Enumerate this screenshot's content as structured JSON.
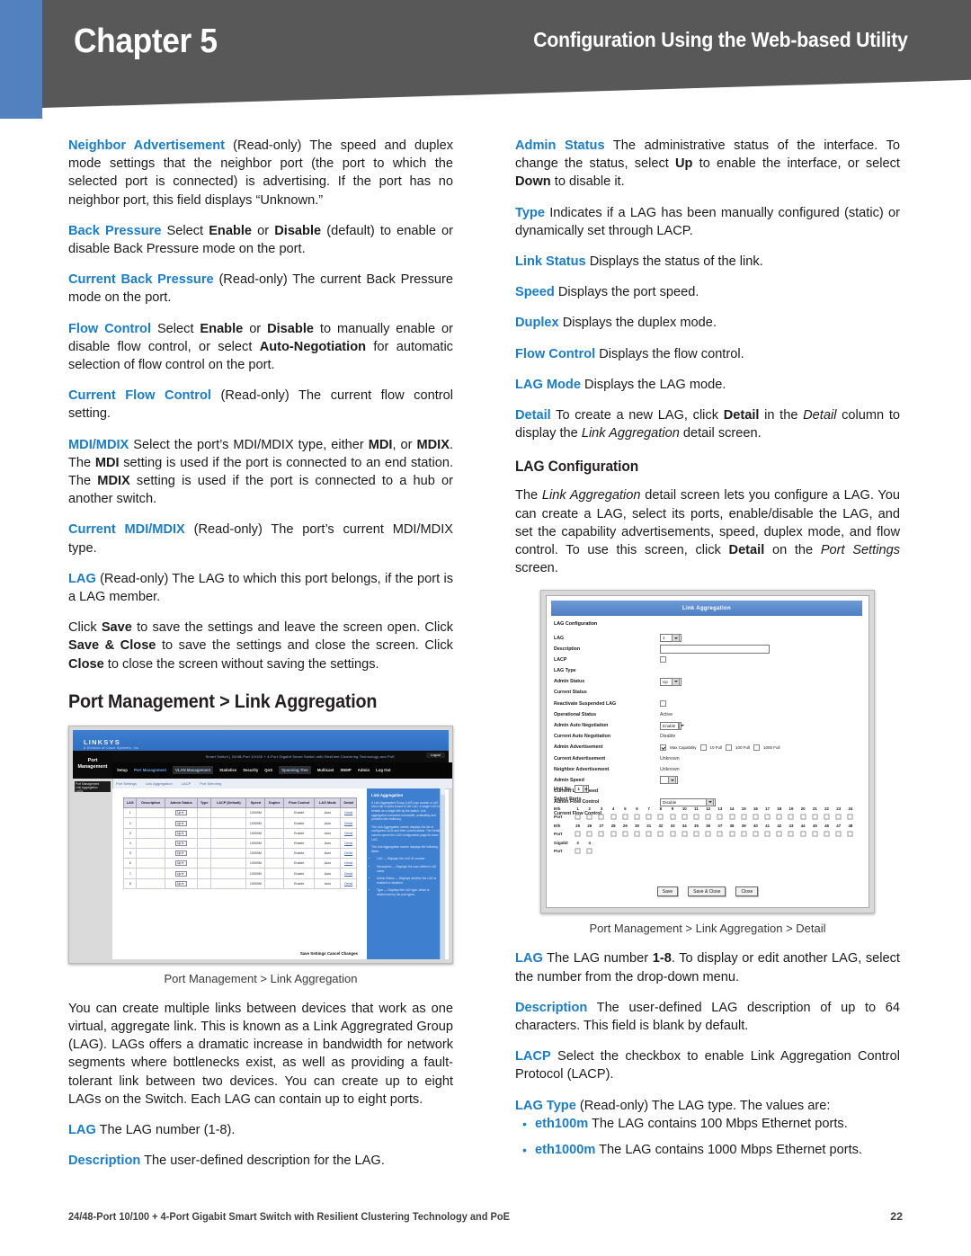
{
  "header": {
    "chapter_label": "Chapter",
    "chapter_number": "5",
    "chapter_title": "Chapter 5",
    "section_title": "Configuration Using the Web-based Utility",
    "bar_color": "#585858",
    "accent_color": "#5381bf"
  },
  "theme": {
    "lead_color": "#1c7cc4",
    "body_color": "#1b1b1b"
  },
  "left_column": {
    "paragraphs": [
      {
        "lead": "Neighbor Advertisement",
        "text": " (Read-only) The speed and duplex mode settings that the neighbor port (the port to which the selected port is connected) is advertising. If the port has no neighbor port, this field displays “Unknown.”"
      },
      {
        "lead": "Back Pressure",
        "text": " Select Enable or Disable (default) to enable or disable Back Pressure mode on the port."
      },
      {
        "lead": "Current Back Pressure",
        "text": " (Read-only) The current Back Pressure mode on the port."
      },
      {
        "lead": "Flow Control",
        "text": " Select Enable or Disable to manually enable or disable flow control, or select Auto-Negotiation for automatic selection of flow control on the port."
      },
      {
        "lead": "Current Flow Control",
        "text": " (Read-only) The current flow control setting."
      },
      {
        "lead": "MDI/MDIX",
        "text": " Select the port’s MDI/MDIX type, either MDI, or MDIX. The MDI setting is used if the port is connected to an end station. The MDIX setting is used if the port is connected to a hub or another switch."
      },
      {
        "lead": "Current MDI/MDIX",
        "text": " (Read-only) The port’s current MDI/MDIX type."
      },
      {
        "lead": "LAG",
        "text": " (Read-only) The LAG to which this port belongs, if the port is a LAG member."
      },
      {
        "lead": "",
        "text": "Click Save to save the settings and leave the screen open. Click Save & Close to save the settings and close the screen. Click Close to close the screen without saving the settings."
      }
    ],
    "section_heading": "Port Management > Link Aggregation",
    "figure_caption": "Port Management > Link Aggregation",
    "after_figure_paragraphs": [
      {
        "lead": "",
        "text": "You can create multiple links between devices that work as one virtual, aggregate link. This is known as a Link Aggregrated Group (LAG). LAGs offers a dramatic increase in bandwidth for network segments where bottlenecks exist, as well as providing a fault-tolerant link between two devices. You can create up to eight LAGs on the Switch. Each LAG can contain up to eight ports."
      },
      {
        "lead": "LAG",
        "text": " The LAG number (1-8)."
      },
      {
        "lead": "Description",
        "text": " The user-defined description for the LAG."
      }
    ]
  },
  "right_column": {
    "paragraphs": [
      {
        "lead": "Admin Status",
        "text": " The administrative status of the interface. To change the status, select Up to enable the interface, or select Down to disable it."
      },
      {
        "lead": "Type",
        "text": " Indicates if a LAG has been manually configured (static) or dynamically set through LACP."
      },
      {
        "lead": "Link Status",
        "text": " Displays the status of the link."
      },
      {
        "lead": "Speed",
        "text": " Displays the port speed."
      },
      {
        "lead": "Duplex",
        "text": " Displays the duplex mode."
      },
      {
        "lead": "Flow Control",
        "text": " Displays the flow control."
      },
      {
        "lead": "LAG Mode",
        "text": " Displays the LAG mode."
      },
      {
        "lead": "Detail",
        "text": " To create a new LAG, click Detail in the Detail column to display the Link Aggregation detail screen."
      }
    ],
    "subsection_heading": "LAG Configuration",
    "subsection_paragraph": "The Link Aggregation detail screen lets you configure a LAG. You can create a LAG, select its ports, enable/disable the LAG, and set the capability advertisements, speed, duplex mode, and flow control. To use this screen, click Detail on the Port Settings screen.",
    "figure_caption": "Port Management > Link Aggregation > Detail",
    "after_figure_paragraphs": [
      {
        "lead": "LAG",
        "text": " The LAG number (1-8). To display or edit another LAG, select the number from the drop-down menu."
      },
      {
        "lead": "Description",
        "text": " The user-defined LAG description of up to 64 characters. This field is blank by default."
      },
      {
        "lead": "LACP",
        "text": " Select the checkbox to enable Link Aggregation Control Protocol (LACP)."
      },
      {
        "lead": "LAG Type",
        "text": " (Read-only) The LAG type. The values are:"
      }
    ],
    "bullets": [
      {
        "lead": "eth100m",
        "text": " The LAG contains 100 Mbps Ethernet ports."
      },
      {
        "lead": "eth1000m",
        "text": " The LAG contains 1000 Mbps Ethernet ports."
      }
    ]
  },
  "figure_list_screen": {
    "brand": "LINKSYS",
    "brand_sub": "A Division of Cisco Systems, Inc.",
    "side_tab": "Port Management",
    "top_bar_text": "Smart Switch | 24/48-Port 10/100 + 4-Port Gigabit Smart Switch with Resilient Clustering Technology and PoE",
    "logout_label": "Logout",
    "menu_items": [
      "Setup",
      "Port Management",
      "VLAN Management",
      "Statistics",
      "Security",
      "QoS",
      "Spanning Tree",
      "Multicast",
      "SNMP",
      "Admin",
      "Log Out"
    ],
    "sub_items": [
      "Port Settings",
      "Link Aggregation",
      "LACP",
      "Port Mirroring"
    ],
    "left_nav": [
      "Port Management",
      "Link Aggregation",
      "LAGs"
    ],
    "table": {
      "columns": [
        "LAG",
        "Description",
        "Admin Status",
        "Type",
        "LACP (Default)",
        "Speed",
        "Duplex",
        "Flow Control",
        "LAG Mode",
        "Detail"
      ],
      "rows": [
        [
          "1",
          "",
          "Up",
          "",
          "",
          "10000M",
          "",
          "Enable",
          "Auto",
          "Detail"
        ],
        [
          "2",
          "",
          "Up",
          "",
          "",
          "10000M",
          "",
          "Enable",
          "Auto",
          "Detail"
        ],
        [
          "3",
          "",
          "Up",
          "",
          "",
          "10000M",
          "",
          "Enable",
          "Auto",
          "Detail"
        ],
        [
          "4",
          "",
          "Up",
          "",
          "",
          "10000M",
          "",
          "Enable",
          "Auto",
          "Detail"
        ],
        [
          "5",
          "",
          "Up",
          "",
          "",
          "10000M",
          "",
          "Enable",
          "Auto",
          "Detail"
        ],
        [
          "6",
          "",
          "Up",
          "",
          "",
          "10000M",
          "",
          "Enable",
          "Auto",
          "Detail"
        ],
        [
          "7",
          "",
          "Up",
          "",
          "",
          "10000M",
          "",
          "Enable",
          "Auto",
          "Detail"
        ],
        [
          "8",
          "",
          "Up",
          "",
          "",
          "10000M",
          "",
          "Enable",
          "Auto",
          "Detail"
        ]
      ]
    },
    "footer_actions": "Save Settings   Cancel Changes",
    "help_panel": {
      "title": "Link Aggregation",
      "paragraphs": [
        "A Link Aggregated Group (LAG) can contain a LAG and a list of ports bound to the LAG. A single LAG is treated as a single link by the switch. Link aggregation increases bandwidth, availability and provides link resiliency.",
        "The Link Aggregation screen displays the list of configured LAGs and their current status. The Detail column opens the LAG configuration page for each LAG.",
        "The Link Aggregation screen displays the following fields:"
      ],
      "bullets": [
        "LAG — Displays the LAG ID number.",
        "Description — Displays the user-defined LAG name.",
        "Admin Status — Displays whether the LAG is enabled or disabled.",
        "Type — Displays the LAG type, which is determined by the port types."
      ]
    }
  },
  "figure_detail_screen": {
    "title": "Link Aggregation",
    "group_heading": "LAG Configuration",
    "fields": [
      {
        "label": "LAG",
        "control": "dropdown",
        "value": "1"
      },
      {
        "label": "Description",
        "control": "text",
        "value": ""
      },
      {
        "label": "LACP",
        "control": "checkbox",
        "value": ""
      },
      {
        "label": "LAG Type",
        "control": "none",
        "value": ""
      },
      {
        "label": "Admin Status",
        "control": "dropdown",
        "value": "Up"
      },
      {
        "label": "Current Status",
        "control": "none",
        "value": ""
      },
      {
        "label": "Reactivate Suspended LAG",
        "control": "checkbox",
        "value": ""
      },
      {
        "label": "Operational Status",
        "control": "text-value",
        "value": "Active"
      },
      {
        "label": "Admin Auto Negotiation",
        "control": "dropdown",
        "value": "Enable"
      },
      {
        "label": "Current Auto Negotiation",
        "control": "text-value",
        "value": "Disable"
      },
      {
        "label": "Admin Advertisement",
        "control": "advertisement",
        "value": ""
      },
      {
        "label": "Current Advertisement",
        "control": "text-value",
        "value": "Unknown"
      },
      {
        "label": "Neighbor Advertisement",
        "control": "text-value",
        "value": "Unknown"
      },
      {
        "label": "Admin Speed",
        "control": "dropdown",
        "value": ""
      },
      {
        "label": "Current LAG Speed",
        "control": "none",
        "value": ""
      },
      {
        "label": "Admin Flow Control",
        "control": "dropdown-wide",
        "value": "Disable"
      },
      {
        "label": "Current Flow Control",
        "control": "none",
        "value": ""
      }
    ],
    "advertisement_options": [
      {
        "label": "Max Capability",
        "checked": true
      },
      {
        "label": "10 Full",
        "checked": false
      },
      {
        "label": "100 Full",
        "checked": false
      },
      {
        "label": "1000 Full",
        "checked": false
      }
    ],
    "unit_label": "Unit No.",
    "unit_value": "1",
    "select_ports_label": "Select Ports",
    "port_rows": [
      {
        "type_label": "Eth",
        "port_label": "Port",
        "numbers": [
          "1",
          "2",
          "3",
          "4",
          "5",
          "6",
          "7",
          "8",
          "9",
          "10",
          "11",
          "12",
          "13",
          "14",
          "15",
          "16",
          "17",
          "18",
          "19",
          "20",
          "21",
          "22",
          "23",
          "24"
        ]
      },
      {
        "type_label": "Eth",
        "port_label": "Port",
        "numbers": [
          "25",
          "26",
          "27",
          "28",
          "29",
          "30",
          "31",
          "32",
          "33",
          "34",
          "35",
          "36",
          "37",
          "38",
          "39",
          "40",
          "41",
          "42",
          "43",
          "44",
          "45",
          "46",
          "47",
          "48"
        ]
      },
      {
        "type_label": "Gigabit",
        "port_label": "Port",
        "numbers": [
          "3",
          "4"
        ]
      }
    ],
    "buttons": [
      "Save",
      "Save & Close",
      "Close"
    ]
  },
  "footer": {
    "product": "24/48-Port 10/100 + 4-Port Gigabit Smart Switch with Resilient Clustering Technology and PoE",
    "page_number": "22"
  }
}
